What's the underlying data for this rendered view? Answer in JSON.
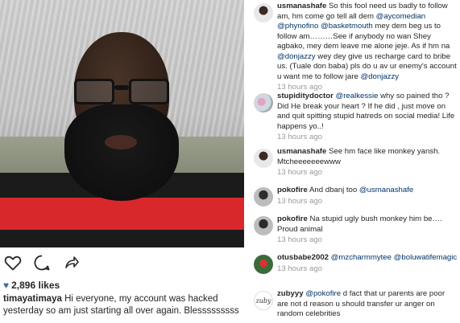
{
  "post": {
    "likes_count": "2,896 likes",
    "caption_user": "timayatimaya",
    "caption_text": " Hi everyone, my account was hacked yesterday so am just starting all over again. Blesssssssss",
    "icons": [
      "heart-outline-icon",
      "comment-bubble-icon",
      "share-arrow-icon"
    ]
  },
  "comments": [
    {
      "user": "usmanashafe",
      "avatar": "avatar-photo",
      "parts": [
        {
          "t": " So this fool need us badly to follow am, hm come go tell all dem "
        },
        {
          "m": "@aycomedian"
        },
        {
          "t": " "
        },
        {
          "m": "@phynofino"
        },
        {
          "t": " "
        },
        {
          "m": "@basketmouth"
        },
        {
          "t": " mey dem beg us to follow am………See if anybody no wan Shey agbako, mey dem leave me alone jeje. As if hm na "
        },
        {
          "m": "@donjazzy"
        },
        {
          "t": " wey dey give us recharge card to bribe us. (Tuale don baba) pls do u av ur enemy's account u want me to follow jare "
        },
        {
          "m": "@donjazzy"
        }
      ],
      "time": "13 hours ago"
    },
    {
      "user": "stupiditydoctor",
      "avatar": "avatar-photo",
      "parts": [
        {
          "t": " "
        },
        {
          "m": "@realkessie"
        },
        {
          "t": " why so pained tho ? Did He break your heart ? If he did , just move on and quit spitting stupid hatreds on social media! Life happens yo..!"
        }
      ],
      "time": "13 hours ago"
    },
    {
      "user": "usmanashafe",
      "avatar": "avatar-photo",
      "parts": [
        {
          "t": " See hm face like monkey yansh. Mtcheeeeeeewww"
        }
      ],
      "time": "13 hours ago"
    },
    {
      "user": "pokofire",
      "avatar": "avatar-photo",
      "parts": [
        {
          "t": " And dbanj too "
        },
        {
          "m": "@usmanashafe"
        }
      ],
      "time": "13 hours ago"
    },
    {
      "user": "pokofire",
      "avatar": "avatar-photo",
      "parts": [
        {
          "t": " Na stupid ugly bush monkey him be…. Proud animal"
        }
      ],
      "time": "13 hours ago"
    },
    {
      "user": "otusbabe2002",
      "avatar": "avatar-photo",
      "parts": [
        {
          "t": " "
        },
        {
          "m": "@mzcharmmytee"
        },
        {
          "t": " "
        },
        {
          "m": "@boluwatifemagic"
        }
      ],
      "time": "13 hours ago"
    },
    {
      "user": "zubyyy",
      "avatar": "avatar-logo",
      "avatar_text": "zuby",
      "parts": [
        {
          "t": " "
        },
        {
          "m": "@pokofire"
        },
        {
          "t": " d fact that ur parents are poor are not d reason u should transfer ur anger on random celebrities"
        }
      ],
      "time": ""
    }
  ]
}
